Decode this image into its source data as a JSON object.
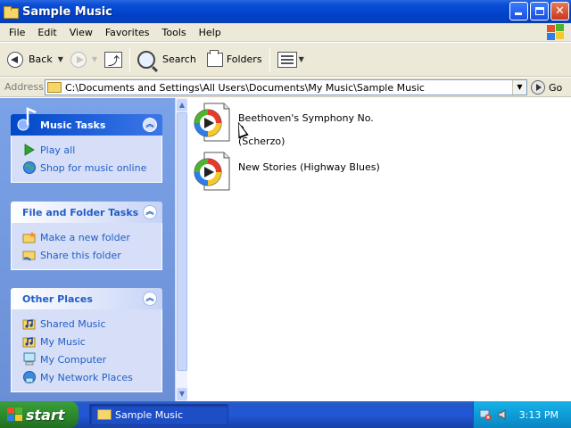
{
  "window": {
    "title": "Sample Music",
    "colors": {
      "titlebar": "#0a4fd6",
      "panel_link": "#215dc6",
      "chrome": "#ece9d8"
    }
  },
  "menu": {
    "items": [
      "File",
      "Edit",
      "View",
      "Favorites",
      "Tools",
      "Help"
    ]
  },
  "toolbar": {
    "back_label": "Back",
    "search_label": "Search",
    "folders_label": "Folders",
    "icons": [
      "back-arrow-icon",
      "forward-arrow-icon",
      "up-folder-icon",
      "search-icon",
      "folders-icon",
      "views-icon"
    ]
  },
  "address": {
    "label": "Address",
    "value": "C:\\Documents and Settings\\All Users\\Documents\\My Music\\Sample Music",
    "go_label": "Go"
  },
  "sidebar": {
    "music_tasks": {
      "title": "Music Tasks",
      "items": [
        {
          "label": "Play all",
          "icon": "play-icon"
        },
        {
          "label": "Shop for music online",
          "icon": "globe-icon"
        }
      ]
    },
    "file_folder_tasks": {
      "title": "File and Folder Tasks",
      "items": [
        {
          "label": "Make a new folder",
          "icon": "new-folder-icon"
        },
        {
          "label": "Share this folder",
          "icon": "share-folder-icon"
        }
      ]
    },
    "other_places": {
      "title": "Other Places",
      "items": [
        {
          "label": "Shared Music",
          "icon": "shared-music-icon"
        },
        {
          "label": "My Music",
          "icon": "my-music-icon"
        },
        {
          "label": "My Computer",
          "icon": "my-computer-icon"
        },
        {
          "label": "My Network Places",
          "icon": "network-places-icon"
        }
      ]
    }
  },
  "files": [
    {
      "name_line1": "Beethoven's Symphony No. 9",
      "name_line2": "(Scherzo)",
      "icon": "windows-media-audio-icon"
    },
    {
      "name_line1": "New Stories (Highway Blues)",
      "name_line2": "",
      "icon": "windows-media-audio-icon"
    }
  ],
  "taskbar": {
    "start_label": "start",
    "task_label": "Sample Music",
    "clock": "3:13 PM"
  }
}
